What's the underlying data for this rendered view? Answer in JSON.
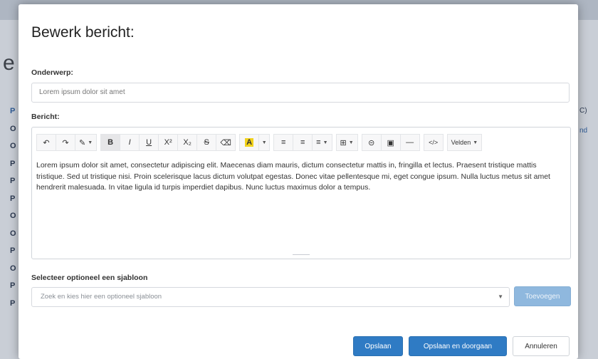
{
  "background": {
    "heading_fragment": "e",
    "left_column_letters": [
      "P",
      "O",
      "O",
      "P",
      "P",
      "P",
      "O",
      "O",
      "P",
      "O",
      "P",
      "P"
    ],
    "right_column_fragments": [
      "C)",
      "nd"
    ]
  },
  "modal": {
    "title": "Bewerk bericht:",
    "subject": {
      "label": "Onderwerp:",
      "value": "Lorem ipsum dolor sit amet"
    },
    "message": {
      "label": "Bericht:",
      "body": "Lorem ipsum dolor sit amet, consectetur adipiscing elit. Maecenas diam mauris, dictum consectetur mattis in, fringilla et lectus. Praesent tristique mattis tristique. Sed ut tristique nisi. Proin scelerisque lacus dictum volutpat egestas. Donec vitae pellentesque mi, eget congue ipsum. Nulla luctus metus sit amet hendrerit malesuada. In vitae ligula id turpis imperdiet dapibus. Nunc luctus maximus dolor a tempus."
    },
    "toolbar": {
      "undo": "↶",
      "redo": "↷",
      "magic": "✎",
      "bold": "B",
      "italic": "I",
      "underline": "U",
      "superscript": "X²",
      "subscript": "X₂",
      "strikethrough": "S",
      "eraser": "⌫",
      "highlight": "A",
      "unordered_list": "≡",
      "ordered_list": "≡",
      "align": "≡",
      "table": "⊞",
      "link": "⊝",
      "image": "▣",
      "hr": "—",
      "code": "</>",
      "variables": "Velden"
    },
    "template": {
      "label": "Selecteer optioneel een sjabloon",
      "placeholder": "Zoek en kies hier een optioneel sjabloon",
      "add_button": "Toevoegen"
    },
    "footer": {
      "save": "Opslaan",
      "save_continue": "Opslaan en doorgaan",
      "cancel": "Annuleren"
    }
  },
  "colors": {
    "primary": "#2f7bc4",
    "primary_disabled": "#8fb8de",
    "highlight_yellow": "#f2d21b"
  }
}
